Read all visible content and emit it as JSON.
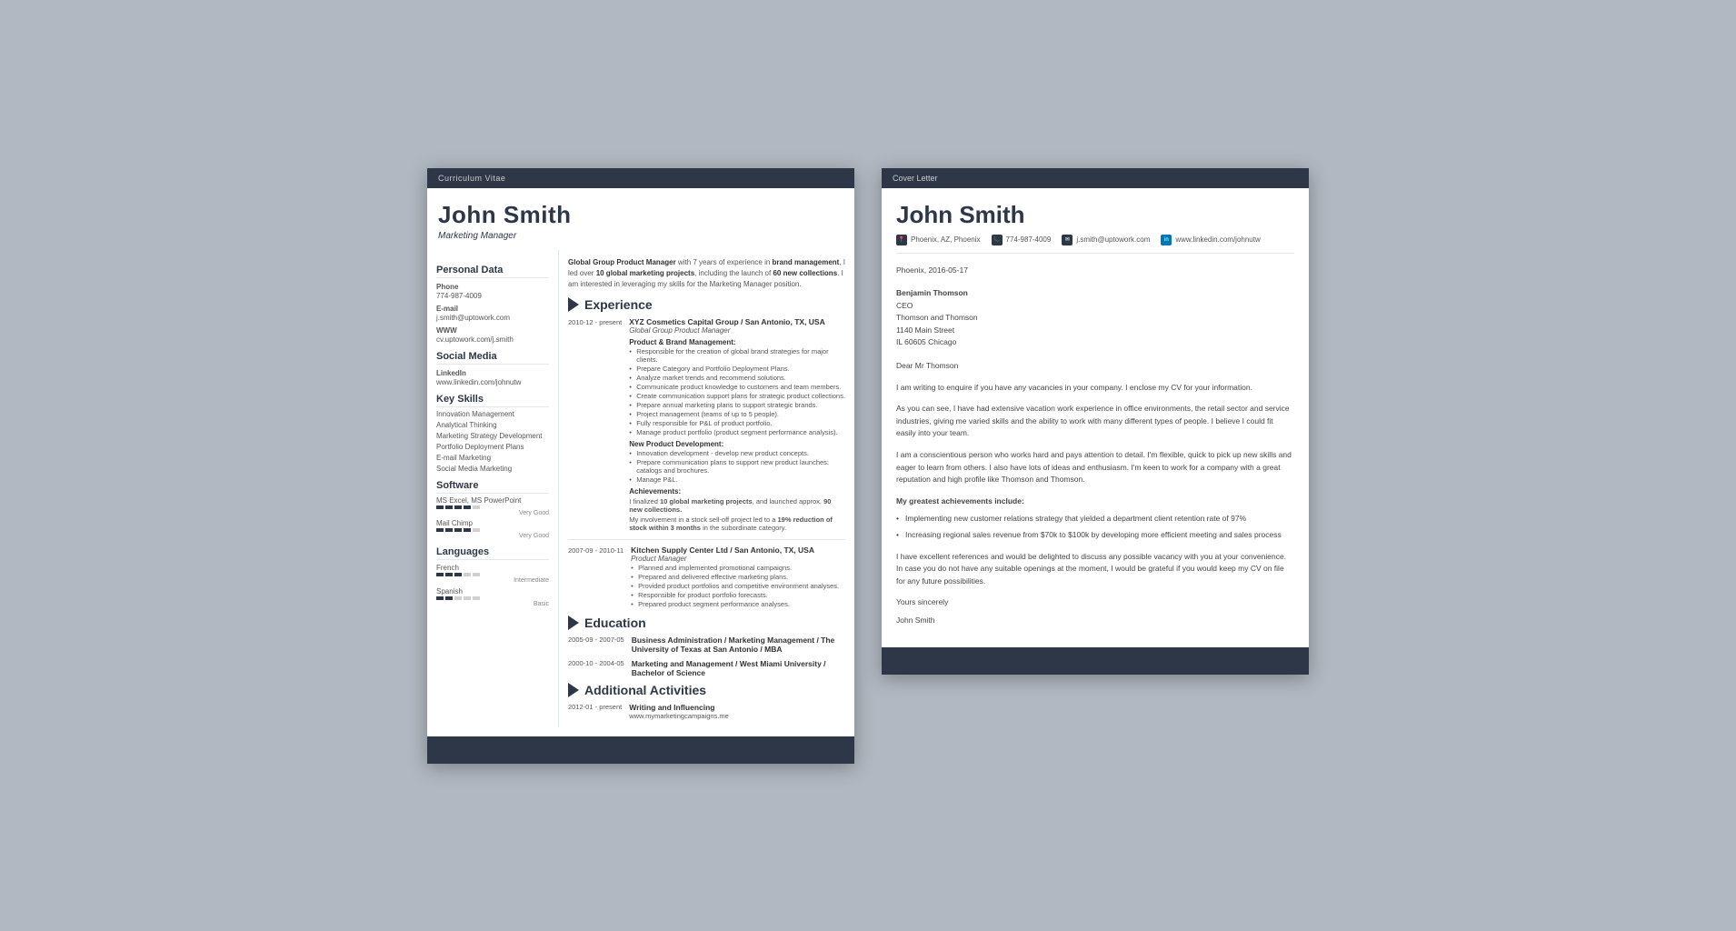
{
  "cv": {
    "header_bar": "Curriculum Vitae",
    "name": "John Smith",
    "title": "Marketing Manager",
    "intro": {
      "part1": "Global Group Product Manager",
      "part2": " with 7 years of experience in ",
      "bold1": "brand management",
      "part3": ", I led over ",
      "bold2": "10 global marketing projects",
      "part4": ", including the launch of ",
      "bold3": "60 new collections",
      "part5": ". I am interested in leveraging my skills for the Marketing Manager position."
    },
    "sidebar": {
      "personal_data_title": "Personal Data",
      "phone_label": "Phone",
      "phone_value": "774-987-4009",
      "email_label": "E-mail",
      "email_value": "j.smith@uptowork.com",
      "www_label": "WWW",
      "www_value": "cv.uptowork.com/j.smith",
      "social_media_title": "Social Media",
      "linkedin_label": "LinkedIn",
      "linkedin_value": "www.linkedin.com/johnutw",
      "key_skills_title": "Key Skills",
      "skills": [
        "Innovation Management",
        "Analytical Thinking",
        "Marketing Strategy Development",
        "Portfolio Deployment Plans",
        "E-mail Marketing",
        "Social Media Marketing"
      ],
      "software_title": "Software",
      "software_items": [
        {
          "name": "MS Excel, MS PowerPoint",
          "rating": 4,
          "max": 5,
          "label": "Very Good"
        },
        {
          "name": "Mail Chimp",
          "rating": 4,
          "max": 5,
          "label": "Very Good"
        }
      ],
      "languages_title": "Languages",
      "languages": [
        {
          "name": "French",
          "rating": 3,
          "max": 5,
          "label": "Intermediate"
        },
        {
          "name": "Spanish",
          "rating": 2,
          "max": 5,
          "label": "Basic"
        }
      ]
    },
    "experience_title": "Experience",
    "experiences": [
      {
        "dates": "2010-12 - present",
        "company": "XYZ Cosmetics Capital Group / San Antonio, TX, USA",
        "role": "Global Group Product Manager",
        "sections": [
          {
            "title": "Product & Brand Management:",
            "bullets": [
              "Responsible for the creation of global brand strategies for major clients.",
              "Prepare Category and Portfolio Deployment Plans.",
              "Analyze market trends and recommend solutions.",
              "Communicate product knowledge to customers and team members.",
              "Create communication support plans for strategic product collections.",
              "Prepare annual marketing plans to support strategic brands.",
              "Project management (teams of up to 5 people).",
              "Fully responsible for P&L of product portfolio.",
              "Manage product portfolio (product segment performance analysis)."
            ]
          },
          {
            "title": "New Product Development:",
            "bullets": [
              "Innovation development - develop new product concepts.",
              "Prepare communication plans to support new product launches: catalogs and brochures.",
              "Manage P&L."
            ]
          }
        ],
        "achievements_title": "Achievements:",
        "achievements": [
          "I finalized 10 global marketing projects, and launched approx. 90 new collections.",
          "My involvement in a stock sell-off project led to a 19% reduction of stock within 3 months in the subordinate category."
        ]
      },
      {
        "dates": "2007-09 - 2010-11",
        "company": "Kitchen Supply Center Ltd / San Antonio, TX, USA",
        "role": "Product Manager",
        "bullets": [
          "Planned and implemented promotional campaigns.",
          "Prepared and delivered effective marketing plans.",
          "Provided product portfolios and competitive environment analyses.",
          "Responsible for product portfolio forecasts.",
          "Prepared product segment performance analyses."
        ]
      }
    ],
    "education_title": "Education",
    "education": [
      {
        "dates": "2005-09 - 2007-05",
        "degree": "Business Administration / Marketing Management / The University of Texas at San Antonio / MBA"
      },
      {
        "dates": "2000-10 - 2004-05",
        "degree": "Marketing and Management / West Miami University / Bachelor of Science"
      }
    ],
    "activities_title": "Additional Activities",
    "activities": [
      {
        "dates": "2012-01 - present",
        "title": "Writing and Influencing",
        "url": "www.mymarketingcampaigns.me"
      }
    ]
  },
  "cover_letter": {
    "header_bar": "Cover Letter",
    "name": "John Smith",
    "contact": {
      "location": "Phoenix, AZ, Phoenix",
      "phone": "774-987-4009",
      "email": "j.smith@uptowork.com",
      "linkedin": "www.linkedin.com/johnutw"
    },
    "date": "Phoenix, 2016-05-17",
    "recipient": {
      "name": "Benjamin Thomson",
      "title": "CEO",
      "company": "Thomson and Thomson",
      "address": "1140 Main Street",
      "city": "IL 60605 Chicago"
    },
    "greeting": "Dear Mr Thomson",
    "paragraphs": [
      "I am writing to enquire if you have any vacancies in your company. I enclose my CV for your information.",
      "As you can see, I have had extensive vacation work experience in office environments, the retail sector and service industries, giving me varied skills and the ability to work with many different types of people. I believe I could fit easily into your team.",
      "I am a conscientious person who works hard and pays attention to detail. I'm flexible, quick to pick up new skills and eager to learn from others. I also have lots of ideas and enthusiasm. I'm keen to work for a company with a great reputation and high profile like Thomson and Thomson."
    ],
    "achievements_title": "My greatest achievements include:",
    "achievements": [
      "Implementing new customer relations strategy that yielded a department client retention rate of 97%",
      "Increasing regional sales revenue from $70k to $100k by developing more efficient meeting and sales process"
    ],
    "closing_para": "I have excellent references and would be delighted to discuss any possible vacancy with you at your convenience. In case you do not have any suitable openings at the moment, I would be grateful if you would keep my CV on file for any future possibilities.",
    "closing": "Yours sincerely",
    "signature": "John Smith"
  }
}
